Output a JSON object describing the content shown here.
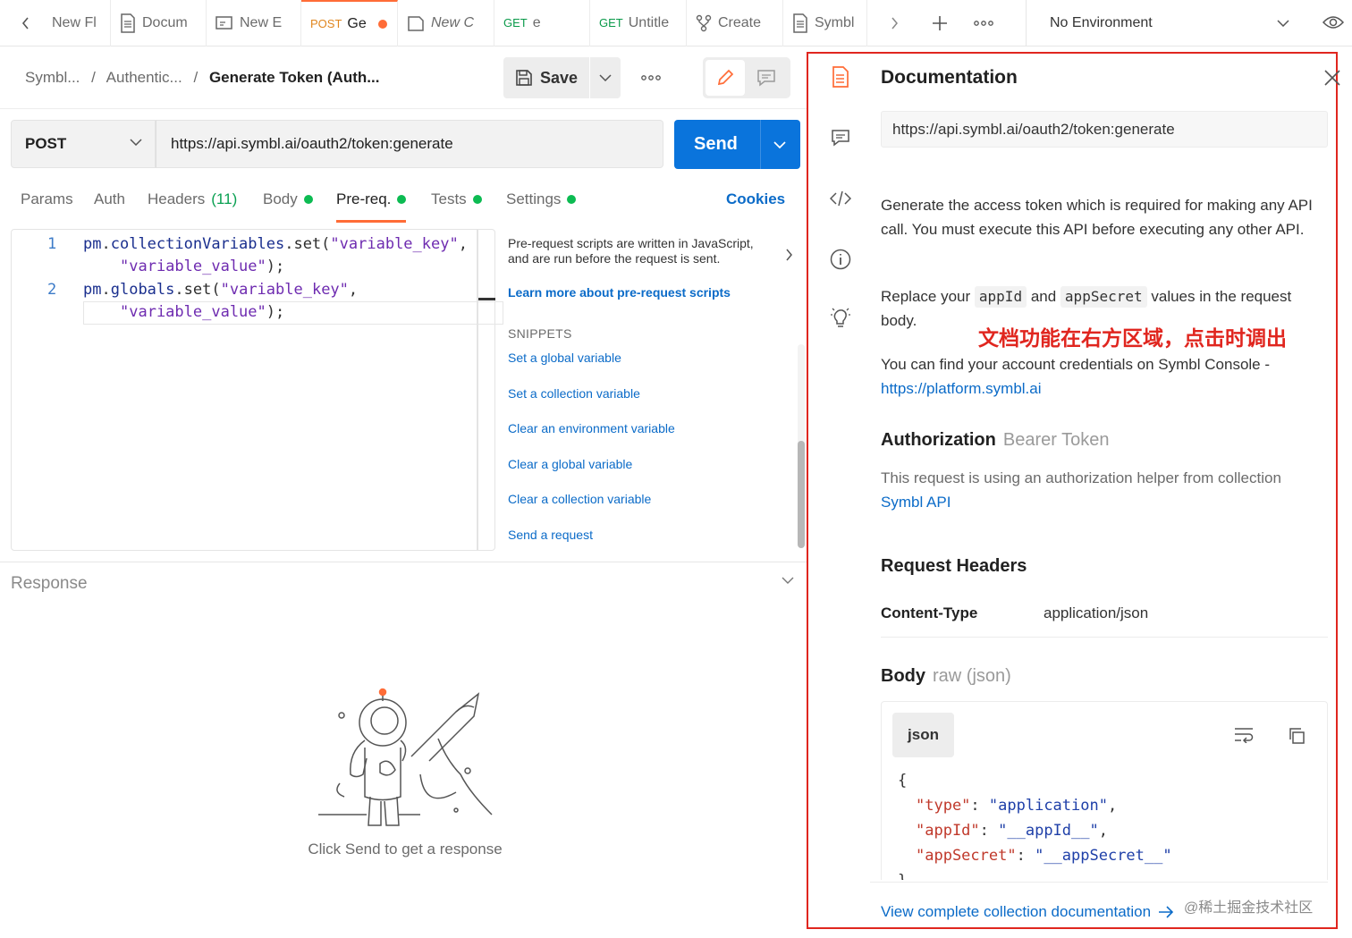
{
  "tabs": [
    {
      "method": "",
      "label": "New Fl",
      "italic": false
    },
    {
      "method": "",
      "label": "Docum",
      "italic": false
    },
    {
      "method": "",
      "label": "New E",
      "italic": false
    },
    {
      "method": "POST",
      "label": "Ge",
      "italic": false
    },
    {
      "method": "",
      "label": "New C",
      "italic": true
    },
    {
      "method": "GET",
      "label": "e",
      "italic": false
    },
    {
      "method": "GET",
      "label": "Untitle",
      "italic": false
    },
    {
      "method": "",
      "label": "Create",
      "italic": false
    },
    {
      "method": "",
      "label": "Symbl",
      "italic": false
    }
  ],
  "environment": "No Environment",
  "breadcrumb": {
    "part1": "Symbl...",
    "sep": "/",
    "part2": "Authentic...",
    "part3": "Generate Token (Auth..."
  },
  "toolbar": {
    "save_label": "Save"
  },
  "request": {
    "method": "POST",
    "url": "https://api.symbl.ai/oauth2/token:generate",
    "send_label": "Send"
  },
  "request_tabs": {
    "params": "Params",
    "auth": "Auth",
    "headers": "Headers",
    "headers_count": "(11)",
    "body": "Body",
    "prereq": "Pre-req.",
    "tests": "Tests",
    "settings": "Settings",
    "cookies": "Cookies"
  },
  "editor": {
    "line1_no": "1",
    "line2_no": "2",
    "l1a": "pm",
    "l1b": ".",
    "l1c": "collectionVariables",
    "l1d": ".",
    "l1e": "set",
    "l1f": "(",
    "l1g": "\"variable_key\"",
    "l1h": ",",
    "l1i": "\"variable_value\"",
    "l1j": ");",
    "l2a": "pm",
    "l2b": ".",
    "l2c": "globals",
    "l2d": ".",
    "l2e": "set",
    "l2f": "(",
    "l2g": "\"variable_key\"",
    "l2h": ",",
    "l2i": "\"variable_value\"",
    "l2j": ");"
  },
  "snippets_panel": {
    "description": "Pre-request scripts are written in JavaScript, and are run before the request is sent.",
    "learn_more": "Learn more about pre-request scripts",
    "heading": "SNIPPETS",
    "items": [
      "Set a global variable",
      "Set a collection variable",
      "Clear an environment variable",
      "Clear a global variable",
      "Clear a collection variable",
      "Send a request"
    ]
  },
  "response": {
    "title": "Response",
    "empty_message": "Click Send to get a response"
  },
  "docs": {
    "title": "Documentation",
    "url": "https://api.symbl.ai/oauth2/token:generate",
    "desc1": "Generate the access token which is required for making any API call. You must execute this API before executing any other API.",
    "replace_a": "Replace your",
    "code1": "appId",
    "replace_b": "and",
    "code2": "appSecret",
    "replace_c": "values in the request body.",
    "annotation": "文档功能在右方区域，点击时调出",
    "cred_text": "You can find your account credentials on Symbl Console -",
    "cred_link": "https://platform.symbl.ai",
    "auth_title": "Authorization",
    "auth_type": "Bearer Token",
    "auth_desc": "This request is using an authorization helper from collection",
    "auth_link": "Symbl API",
    "headers_title": "Request Headers",
    "header_key": "Content-Type",
    "header_value": "application/json",
    "body_title": "Body",
    "body_type": "raw (json)",
    "json_tag": "json",
    "json_open": "{",
    "j1k": "\"type\"",
    "j1v": "\"application\"",
    "j2k": "\"appId\"",
    "j2v": "\"__appId__\"",
    "j3k": "\"appSecret\"",
    "j3v": "\"__appSecret__\"",
    "json_close": "}",
    "view_all": "View complete collection documentation",
    "watermark": "@稀土掘金技术社区"
  },
  "colors": {
    "accent": "#ff6c37",
    "send": "#0a74dc",
    "link": "#0b6bc8",
    "annotation": "#e0261f",
    "green": "#0cbb52"
  }
}
